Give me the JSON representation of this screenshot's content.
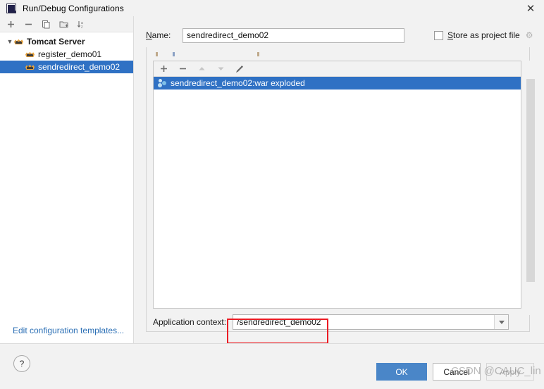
{
  "window": {
    "title": "Run/Debug Configurations",
    "app_icon": "intellij-idea-icon",
    "close_icon": "✕"
  },
  "left_panel": {
    "toolbar": [
      {
        "name": "add-configuration-button",
        "glyph": "+"
      },
      {
        "name": "remove-configuration-button",
        "glyph": "−"
      },
      {
        "name": "copy-configuration-button",
        "glyph": "❐"
      },
      {
        "name": "save-configuration-button",
        "glyph": "🗀"
      },
      {
        "name": "sort-configurations-button",
        "glyph": "↓"
      }
    ],
    "tree": [
      {
        "label": "Tomcat Server",
        "level": 0,
        "bold": true,
        "selected": false,
        "expanded": true,
        "icon": "tomcat-icon"
      },
      {
        "label": "register_demo01",
        "level": 1,
        "bold": false,
        "selected": false,
        "expanded": false,
        "icon": "tomcat-icon"
      },
      {
        "label": "sendredirect_demo02",
        "level": 1,
        "bold": false,
        "selected": true,
        "expanded": false,
        "icon": "tomcat-icon"
      }
    ],
    "edit_templates_link": "Edit configuration templates..."
  },
  "form": {
    "name_label": "Name:",
    "name_label_mnemonic": "N",
    "name_value": "sendredirect_demo02",
    "name_placeholder": "",
    "store_as_project_file_label": "Store as project file",
    "store_as_project_file_mnemonic": "S",
    "store_as_project_file_checked": false,
    "gear_icon": "⚙"
  },
  "deployment": {
    "toolbar": [
      {
        "name": "add-artifact-button",
        "glyph": "+",
        "disabled": false
      },
      {
        "name": "remove-artifact-button",
        "glyph": "−",
        "disabled": false
      },
      {
        "name": "move-up-button",
        "glyph": "▲",
        "disabled": true
      },
      {
        "name": "move-down-button",
        "glyph": "▼",
        "disabled": true
      },
      {
        "name": "edit-artifact-button",
        "glyph": "✎",
        "disabled": false
      }
    ],
    "artifacts": [
      {
        "label": "sendredirect_demo02:war exploded",
        "selected": true,
        "icon": "artifact-icon"
      }
    ],
    "application_context_label": "Application context:",
    "application_context_value": "/sendredirect_demo02",
    "application_context_placeholder": "",
    "dropdown_icon": "chevron-down-icon"
  },
  "footer": {
    "help_label": "?",
    "ok_label": "OK",
    "cancel_label": "Cancel",
    "apply_label": "Apply",
    "apply_disabled": true
  },
  "watermark": {
    "text": "CSDN @CAUC_lin"
  },
  "colors": {
    "selection_blue": "#2f71c4",
    "primary_button": "#4a86c8",
    "link_blue": "#2b6fb5",
    "annotation_red": "#ec1c24",
    "dialog_bg": "#f2f2f2"
  }
}
